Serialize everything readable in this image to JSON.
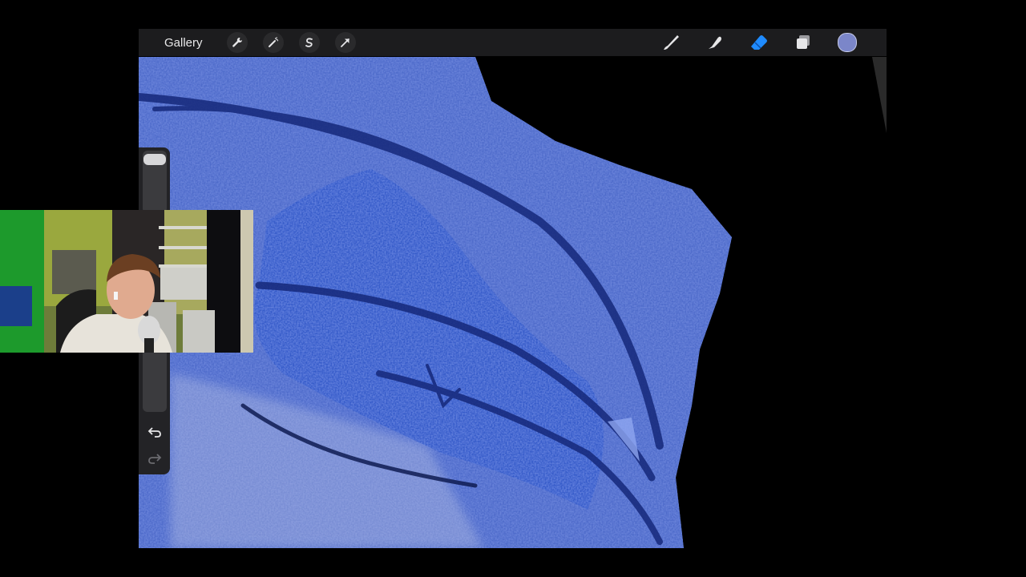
{
  "toolbar": {
    "gallery_label": "Gallery",
    "left_icons": [
      "wrench-icon",
      "magic-wand-icon",
      "selection-s-icon",
      "transform-arrow-icon"
    ],
    "right_icons": [
      "brush-icon",
      "smudge-icon",
      "eraser-icon",
      "layers-icon",
      "color-swatch"
    ],
    "active_tool": "eraser",
    "accent_color": "#1f8bff",
    "current_color": "#7b86c9"
  },
  "sidebar": {
    "icons": [
      "brush-size-slider",
      "modify-square-button",
      "opacity-slider",
      "undo-icon",
      "redo-icon"
    ]
  },
  "canvas": {
    "background_color": "#000000",
    "paint_color": "#3a5bd0"
  }
}
